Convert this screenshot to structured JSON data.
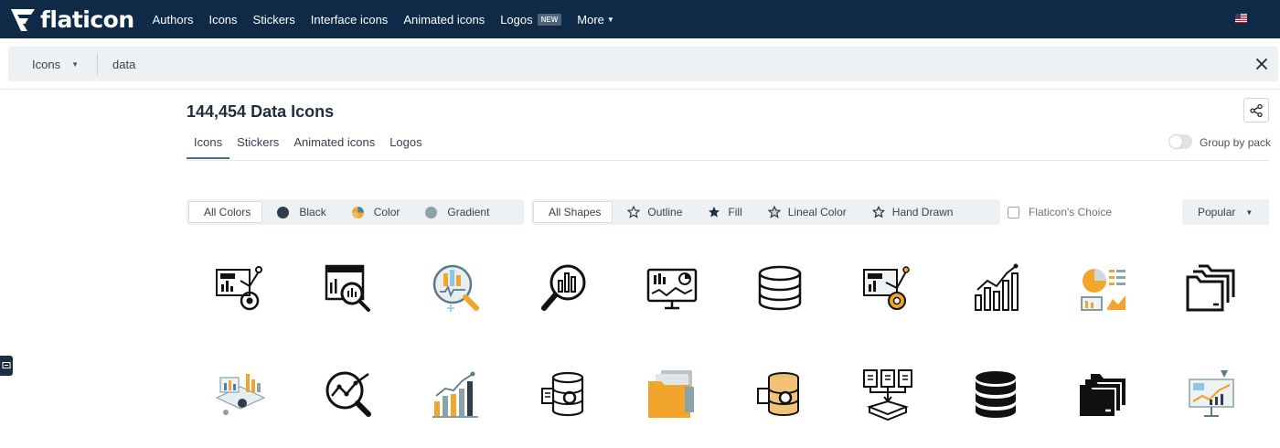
{
  "header": {
    "logo_text": "flaticon",
    "nav": [
      {
        "label": "Authors"
      },
      {
        "label": "Icons"
      },
      {
        "label": "Stickers"
      },
      {
        "label": "Interface icons"
      },
      {
        "label": "Animated icons"
      },
      {
        "label": "Logos",
        "badge": "NEW"
      },
      {
        "label": "More"
      }
    ],
    "flag_icon": "flag-icon"
  },
  "search": {
    "type_label": "Icons",
    "value": "data",
    "clear_icon": "close-icon"
  },
  "results": {
    "title": "144,454 Data Icons",
    "tabs": [
      {
        "label": "Icons",
        "active": true
      },
      {
        "label": "Stickers"
      },
      {
        "label": "Animated icons"
      },
      {
        "label": "Logos"
      }
    ],
    "group_by_pack_label": "Group by pack",
    "group_by_pack_enabled": false
  },
  "filters": {
    "colors": [
      {
        "label": "All Colors",
        "active": true
      },
      {
        "label": "Black",
        "dot": "#2f3d4c"
      },
      {
        "label": "Color",
        "dot": "#f2a52b"
      },
      {
        "label": "Gradient",
        "dot": "#8aa2a8"
      }
    ],
    "shapes": [
      {
        "label": "All Shapes",
        "active": true
      },
      {
        "label": "Outline",
        "icon": "star-outline-icon"
      },
      {
        "label": "Fill",
        "icon": "star-fill-icon"
      },
      {
        "label": "Lineal Color",
        "icon": "star-lineal-icon"
      },
      {
        "label": "Hand Drawn",
        "icon": "star-hand-drawn-icon"
      }
    ],
    "flaticons_choice_label": "Flaticon's Choice",
    "sort_label": "Popular"
  },
  "colors": {
    "nav_bg": "#0e2a47",
    "accent_yellow": "#f2a52b",
    "accent_teal": "#8aa2a8"
  },
  "icons": [
    {
      "name": "data-analytics-icon"
    },
    {
      "name": "data-analysis-screen-icon"
    },
    {
      "name": "data-search-magnifier-icon"
    },
    {
      "name": "chart-magnifier-icon"
    },
    {
      "name": "monitor-dashboard-icon"
    },
    {
      "name": "database-icon"
    },
    {
      "name": "data-analytics-color-icon"
    },
    {
      "name": "growth-bar-chart-icon"
    },
    {
      "name": "report-charts-icon"
    },
    {
      "name": "folders-icon"
    },
    {
      "name": "isometric-dashboard-icon"
    },
    {
      "name": "trend-magnifier-icon"
    },
    {
      "name": "growth-chart-color-icon"
    },
    {
      "name": "database-settings-icon"
    },
    {
      "name": "yellow-folders-icon"
    },
    {
      "name": "database-gear-color-icon"
    },
    {
      "name": "data-flow-documents-icon"
    },
    {
      "name": "database-fill-icon"
    },
    {
      "name": "folders-fill-icon"
    },
    {
      "name": "presentation-board-icon"
    }
  ]
}
